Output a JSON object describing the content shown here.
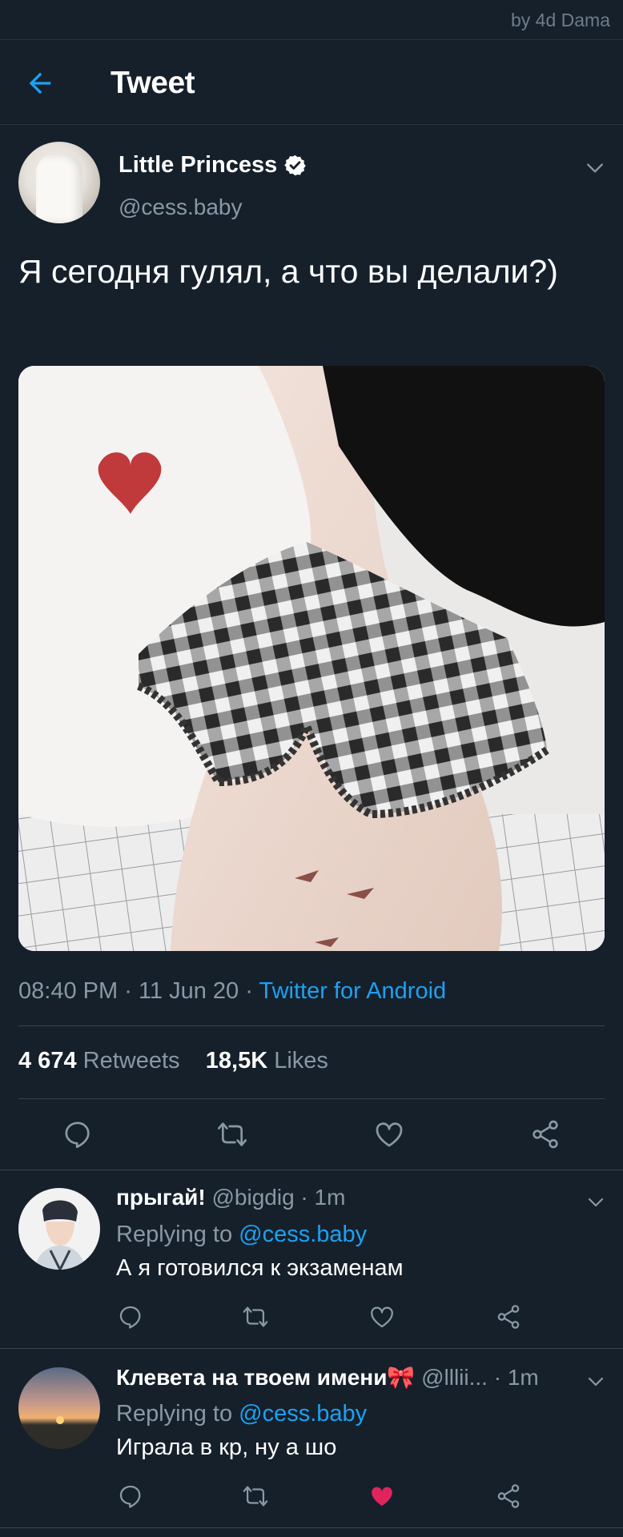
{
  "watermark": "by 4d Dama",
  "header": {
    "title": "Tweet",
    "back_icon": "arrow-left-icon"
  },
  "tweet": {
    "author_name": "Little Princess",
    "author_handle": "@cess.baby",
    "verified": true,
    "text": "Я сегодня гулял, а что вы делали?)",
    "time": "08:40 PM",
    "date": "11 Jun 20",
    "dot": "·",
    "source": "Twitter for Android",
    "retweets_count": "4 674",
    "retweets_label": "Retweets",
    "likes_count": "18,5K",
    "likes_label": "Likes"
  },
  "replies": [
    {
      "name": "прыгай!",
      "handle": "@bigdig",
      "time": "· 1m",
      "replying_prefix": "Replying to",
      "replying_to": "@cess.baby",
      "text": "А я готовился к экзаменам",
      "liked": false
    },
    {
      "name": "Клевета на твоем имени🎀",
      "handle": "@lllii...",
      "time": "· 1m",
      "replying_prefix": "Replying to",
      "replying_to": "@cess.baby",
      "text": "Играла в кр, ну а шо",
      "liked": true
    }
  ],
  "colors": {
    "background": "#15202b",
    "accent": "#1da1f2",
    "secondary_text": "#8899a6",
    "like_active": "#e0245e"
  }
}
